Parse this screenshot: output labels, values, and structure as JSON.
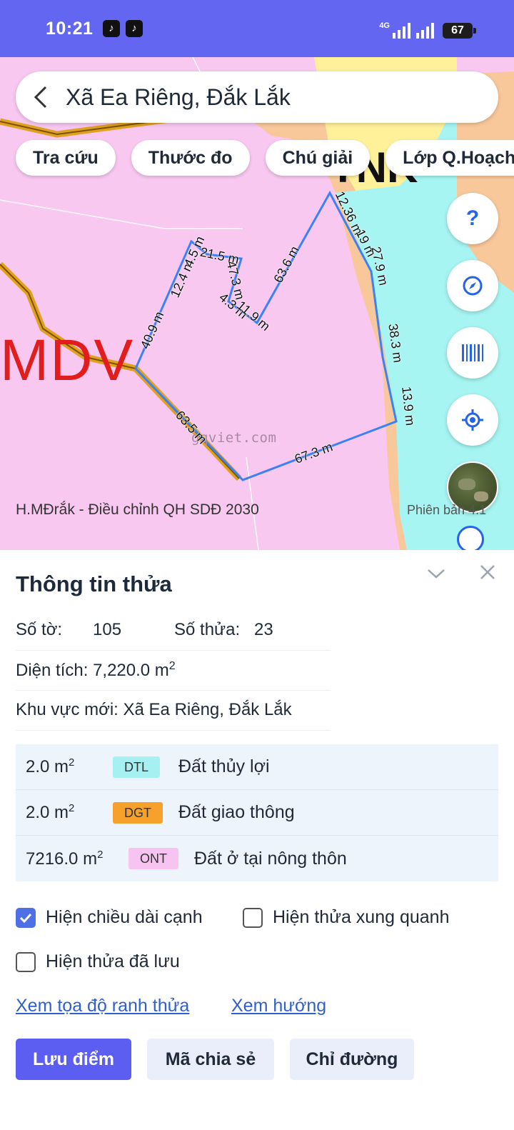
{
  "status_bar": {
    "time": "10:21",
    "network": "4G",
    "battery": "67",
    "notification_icons": [
      "tiktok-icon",
      "tiktok-icon"
    ]
  },
  "search": {
    "title": "Xã Ea Riêng, Đắk Lắk"
  },
  "chips": [
    "Tra cứu",
    "Thước đo",
    "Chú giải",
    "Lớp Q.Hoạch"
  ],
  "map": {
    "zone_labels": [
      "MDV",
      "TNK"
    ],
    "watermark": "gqviet.com",
    "caption": "H.MĐrắk - Điều chỉnh QH SDĐ 2030",
    "version": "Phiên bản 4.1",
    "edge_lengths": [
      "40.9 m",
      "12.4 m",
      "4.5 m",
      "21.5 m",
      "47.3 m",
      "4.3 m",
      "11.9 m",
      "63.6 m",
      "12.36 m",
      "19 m",
      "27.9 m",
      "38.3 m",
      "13.9 m",
      "67.3 m",
      "63.5 m"
    ],
    "fab_icons": [
      "help-icon",
      "compass-icon",
      "barcode-icon",
      "locate-icon",
      "satellite-layer-icon"
    ],
    "fab_help_label": "?"
  },
  "panel": {
    "title": "Thông tin thửa",
    "sheet_label": "Số tờ:",
    "sheet_value": "105",
    "parcel_label": "Số thửa:",
    "parcel_value": "23",
    "area_label": "Diện tích:",
    "area_value": "7,220.0 m",
    "area_unit_sup": "2",
    "region_label": "Khu vực mới:",
    "region_value": "Xã Ea Riêng, Đắk Lắk",
    "land_uses": [
      {
        "area": "2.0 m",
        "sup": "2",
        "code": "DTL",
        "name": "Đất thủy lợi",
        "color": "#a6f0f2"
      },
      {
        "area": "2.0 m",
        "sup": "2",
        "code": "DGT",
        "name": "Đất giao thông",
        "color": "#f5a12b"
      },
      {
        "area": "7216.0 m",
        "sup": "2",
        "code": "ONT",
        "name": "Đất ở tại nông thôn",
        "color": "#f7c3f0"
      }
    ],
    "checkboxes": [
      {
        "label": "Hiện chiều dài cạnh",
        "checked": true
      },
      {
        "label": "Hiện thửa xung quanh",
        "checked": false
      },
      {
        "label": "Hiện thửa đã lưu",
        "checked": false
      }
    ],
    "links": [
      "Xem tọa độ ranh thửa",
      "Xem hướng"
    ],
    "buttons": [
      "Lưu điểm",
      "Mã chia sẻ",
      "Chỉ đường"
    ]
  },
  "colors": {
    "accent": "#5b5ef0",
    "status_bar": "#6366f1",
    "map_pink": "#f8c8f0",
    "map_peach": "#f9c89a",
    "map_cyan": "#a6f5f2",
    "map_yellow": "#fff19a",
    "parcel_outline": "#3b82f6",
    "road": "#e0a020"
  }
}
